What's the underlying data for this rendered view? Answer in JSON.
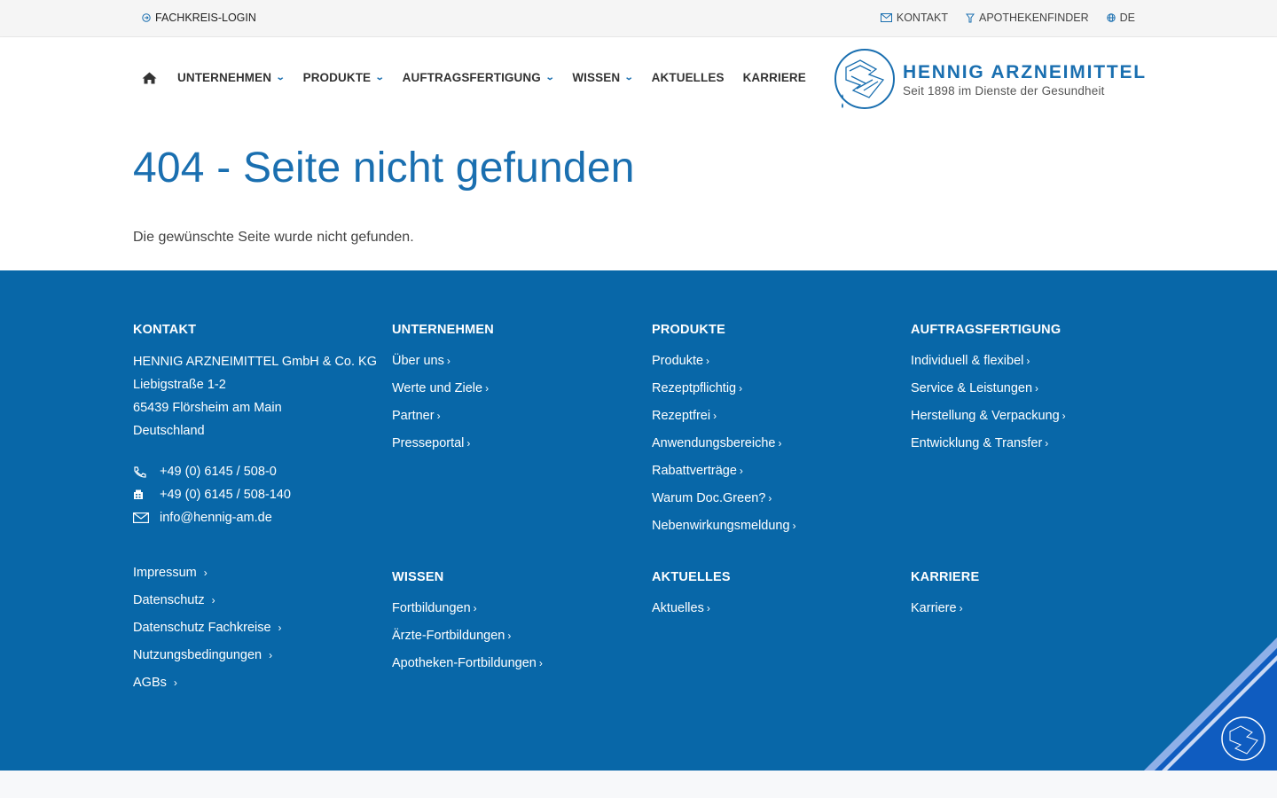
{
  "topbar": {
    "login_label": "FACHKREIS-LOGIN",
    "kontakt_label": "KONTAKT",
    "apotheken_label": "APOTHEKENFINDER",
    "lang_label": "DE"
  },
  "nav": {
    "items": [
      {
        "label": "UNTERNEHMEN"
      },
      {
        "label": "PRODUKTE"
      },
      {
        "label": "AUFTRAGSFERTIGUNG"
      },
      {
        "label": "WISSEN"
      },
      {
        "label": "AKTUELLES"
      },
      {
        "label": "KARRIERE"
      }
    ]
  },
  "logo": {
    "brand": "HENNIG ARZNEIMITTEL",
    "tagline": "Seit 1898 im Dienste der Gesundheit"
  },
  "main": {
    "title": "404 - Seite nicht gefunden",
    "message": "Die gewünschte Seite wurde nicht gefunden."
  },
  "footer": {
    "kontakt": {
      "heading": "KONTAKT",
      "address": [
        "HENNIG ARZNEIMITTEL GmbH & Co. KG",
        "Liebigstraße 1-2",
        "65439 Flörsheim am Main",
        "Deutschland"
      ],
      "phone": "+49 (0) 6145 / 508-0",
      "fax": "+49 (0) 6145 / 508-140",
      "email": "info@hennig-am.de",
      "legal": [
        "Impressum",
        "Datenschutz",
        "Datenschutz Fachkreise",
        "Nutzungsbedingungen",
        "AGBs"
      ]
    },
    "unternehmen": {
      "heading": "UNTERNEHMEN",
      "links": [
        "Über uns",
        "Werte und Ziele",
        "Partner",
        "Presseportal"
      ]
    },
    "produkte": {
      "heading": "PRODUKTE",
      "links": [
        "Produkte",
        "Rezeptpflichtig",
        "Rezeptfrei",
        "Anwendungsbereiche",
        "Rabattverträge",
        "Warum Doc.Green?",
        "Nebenwirkungsmeldung"
      ]
    },
    "auftragsfertigung": {
      "heading": "AUFTRAGSFERTIGUNG",
      "links": [
        "Individuell & flexibel",
        "Service & Leistungen",
        "Herstellung & Verpackung",
        "Entwicklung & Transfer"
      ]
    },
    "wissen": {
      "heading": "WISSEN",
      "links": [
        "Fortbildungen",
        "Ärzte-Fortbildungen",
        "Apotheken-Fortbildungen"
      ]
    },
    "aktuelles": {
      "heading": "AKTUELLES",
      "links": [
        "Aktuelles"
      ]
    },
    "karriere": {
      "heading": "KARRIERE",
      "links": [
        "Karriere"
      ]
    },
    "arrow": "›"
  },
  "colors": {
    "brand_blue": "#1a6fb0",
    "footer_blue": "#0867a8"
  }
}
